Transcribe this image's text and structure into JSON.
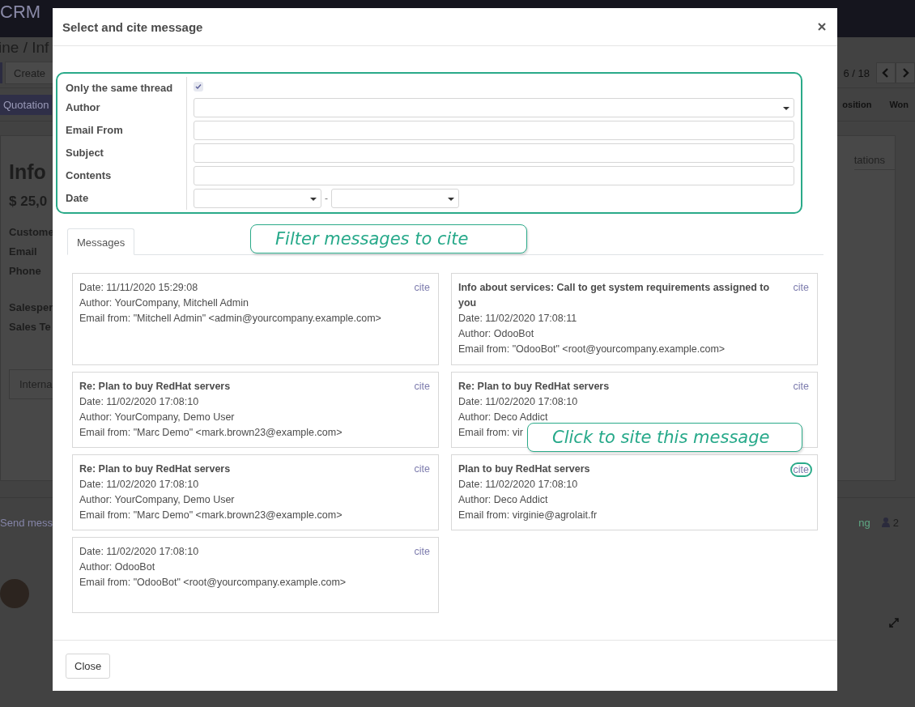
{
  "background": {
    "app_name": "CRM",
    "breadcrumb": "ine / Inf",
    "create_button": "Create",
    "pager": "6 / 18",
    "quotation_button": "Quotation",
    "stages": [
      {
        "label": "osition"
      },
      {
        "label": "Won"
      }
    ],
    "tab": "tations",
    "title": "Info",
    "amount": "$ 25,0",
    "field_groups": [
      [
        "Custome",
        "Email",
        "Phone"
      ],
      [
        "Salesper",
        "Sales Te"
      ]
    ],
    "notebook_tab": "Interna",
    "send_message": "Send mess",
    "follow": "ng",
    "followers": "2"
  },
  "dialog": {
    "title": "Select and cite message",
    "filter": {
      "callout": "Filter messages to cite",
      "fields": [
        {
          "label": "Only the same thread",
          "kind": "checkbox",
          "checked": true
        },
        {
          "label": "Author",
          "kind": "select"
        },
        {
          "label": "Email From",
          "kind": "text"
        },
        {
          "label": "Subject",
          "kind": "text"
        },
        {
          "label": "Contents",
          "kind": "text"
        },
        {
          "label": "Date",
          "kind": "daterange",
          "separator": "-"
        }
      ]
    },
    "tabs": [
      {
        "label": "Messages",
        "selected": true
      }
    ],
    "messages": [
      {
        "date": "Date: 11/11/2020 15:29:08",
        "author": "Author: YourCompany, Mitchell Admin",
        "email": "Email from: \"Mitchell Admin\" <admin@yourcompany.example.com>",
        "cite": "cite"
      },
      {
        "subject": "Info about services: Call to get system requirements assigned to you",
        "date": "Date: 11/02/2020 17:08:11",
        "author": "Author: OdooBot",
        "email": "Email from: \"OdooBot\" <root@yourcompany.example.com>",
        "cite": "cite"
      },
      {
        "subject": "Re: Plan to buy RedHat servers",
        "date": "Date: 11/02/2020 17:08:10",
        "author": "Author: YourCompany, Demo User",
        "email": "Email from: \"Marc Demo\" <mark.brown23@example.com>",
        "cite": "cite"
      },
      {
        "subject": "Re: Plan to buy RedHat servers",
        "date": "Date: 11/02/2020 17:08:10",
        "author": "Author: Deco Addict",
        "email": "Email from: vir",
        "cite": "cite"
      },
      {
        "subject": "Re: Plan to buy RedHat servers",
        "date": "Date: 11/02/2020 17:08:10",
        "author": "Author: YourCompany, Demo User",
        "email": "Email from: \"Marc Demo\" <mark.brown23@example.com>",
        "cite": "cite"
      },
      {
        "subject": "Plan to buy RedHat servers",
        "date": "Date: 11/02/2020 17:08:10",
        "author": "Author: Deco Addict",
        "email": "Email from: virginie@agrolait.fr",
        "cite": "cite",
        "callout": "Click to site this message"
      },
      {
        "date": "Date: 11/02/2020 17:08:10",
        "author": "Author: OdooBot",
        "email": "Email from: \"OdooBot\" <root@yourcompany.example.com>",
        "cite": "cite"
      }
    ],
    "close_button": "Close"
  }
}
